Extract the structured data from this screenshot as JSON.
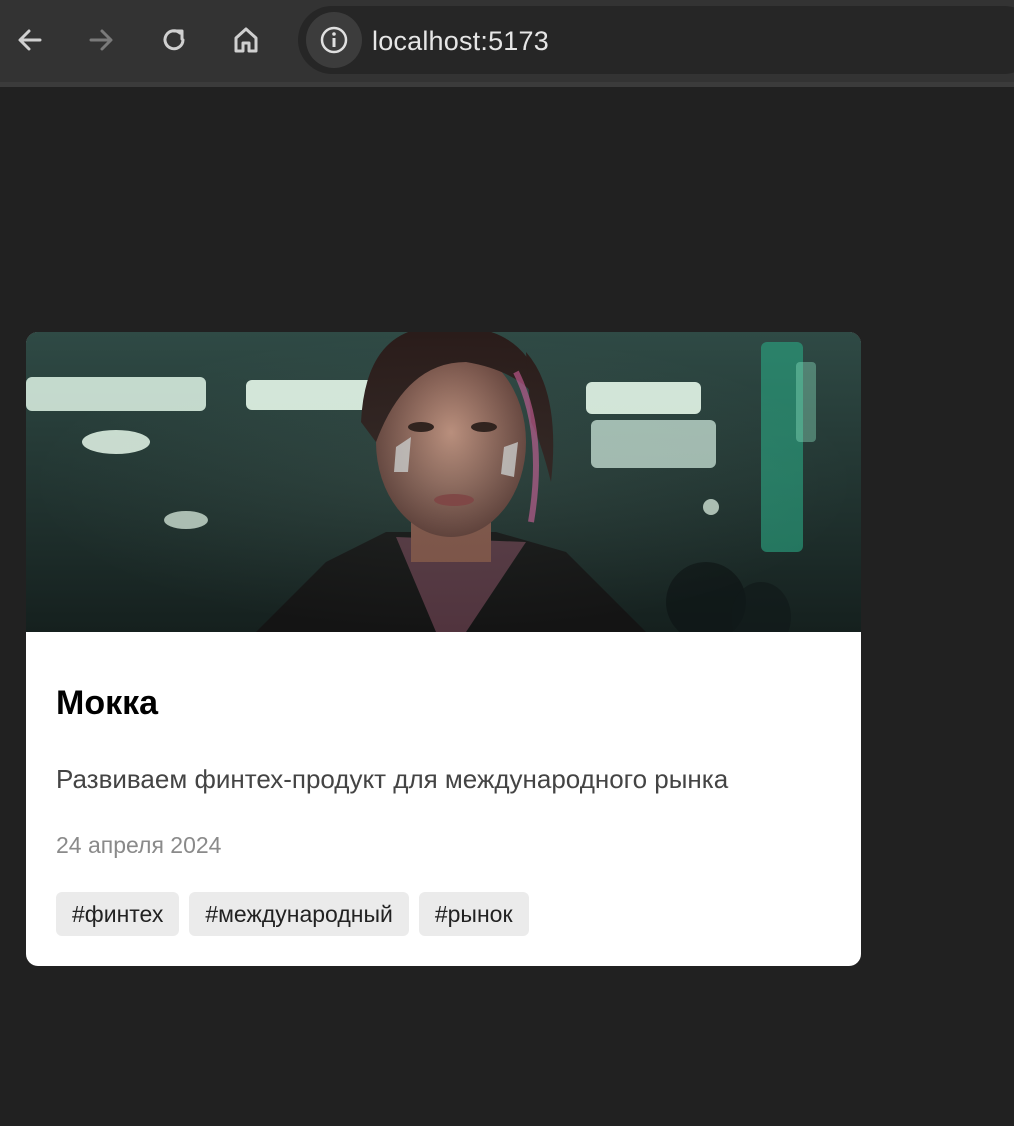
{
  "browser": {
    "url_host": "localhost:",
    "url_port": "5173",
    "back_icon": "arrow-left-icon",
    "forward_icon": "arrow-right-icon",
    "reload_icon": "reload-icon",
    "home_icon": "home-icon",
    "info_icon": "info-icon"
  },
  "card": {
    "image_icon": "cyberpunk-portrait-image",
    "title": "Мокка",
    "description": "Развиваем финтех-продукт для международного рынка",
    "date": "24 апреля 2024",
    "tags": [
      "#финтех",
      "#международный",
      "#рынок"
    ]
  },
  "colors": {
    "page_bg": "#212121",
    "toolbar_bg": "#333333",
    "card_bg": "#ffffff",
    "tag_bg": "#ebebeb"
  }
}
